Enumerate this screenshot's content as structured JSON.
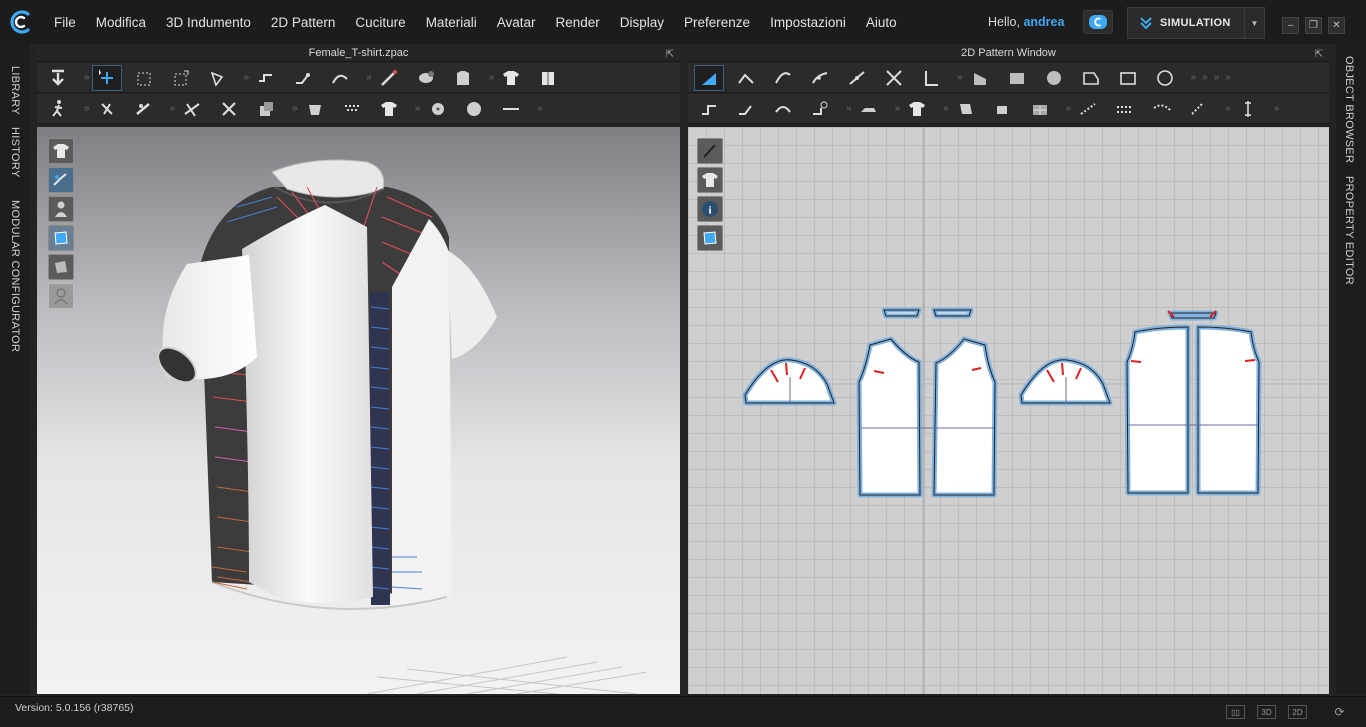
{
  "menubar": {
    "items": [
      "File",
      "Modifica",
      "3D Indumento",
      "2D Pattern",
      "Cuciture",
      "Materiali",
      "Avatar",
      "Render",
      "Display",
      "Preferenze",
      "Impostazioni",
      "Aiuto"
    ],
    "hello_prefix": "Hello,",
    "user_name": "andrea",
    "mode_label": "SIMULATION"
  },
  "left_tabs": [
    "LIBRARY",
    "HISTORY",
    "MODULAR CONFIGURATOR"
  ],
  "right_tabs": [
    "OBJECT BROWSER",
    "PROPERTY EDITOR"
  ],
  "window_3d": {
    "title": "Female_T-shirt.zpac"
  },
  "window_2d": {
    "title": "2D Pattern Window"
  },
  "status": {
    "version": "Version: 5.0.156 (r38765)"
  },
  "status_buttons": [
    "3D",
    "2D"
  ],
  "colors": {
    "accent": "#3fa9f5",
    "seam_red": "#e34b5a",
    "seam_blue": "#4a7fd4",
    "pattern_outline": "#7fb1de"
  }
}
